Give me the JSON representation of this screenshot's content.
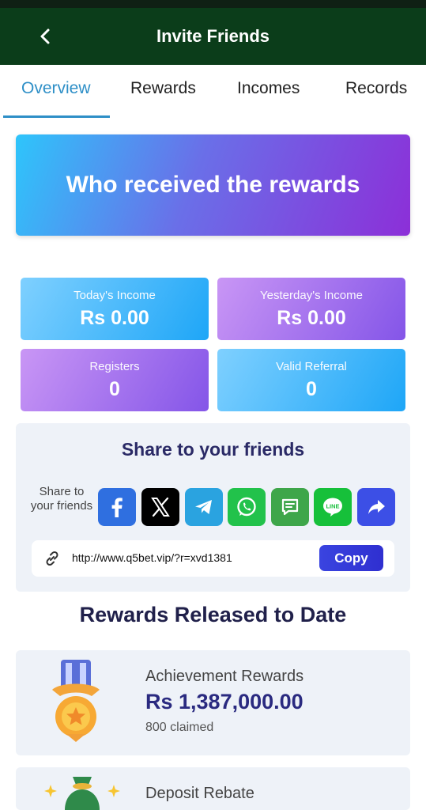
{
  "header": {
    "title": "Invite Friends"
  },
  "tabs": [
    {
      "label": "Overview"
    },
    {
      "label": "Rewards"
    },
    {
      "label": "Incomes"
    },
    {
      "label": "Records"
    }
  ],
  "hero": {
    "text": "Who received the rewards"
  },
  "stats": [
    {
      "label": "Today's Income",
      "value": "Rs 0.00"
    },
    {
      "label": "Yesterday's Income",
      "value": "Rs 0.00"
    },
    {
      "label": "Registers",
      "value": "0"
    },
    {
      "label": "Valid Referral",
      "value": "0"
    }
  ],
  "share": {
    "title": "Share to your friends",
    "label": "Share to your friends",
    "platforms": [
      "facebook-icon",
      "x-icon",
      "telegram-icon",
      "whatsapp-icon",
      "sms-icon",
      "line-icon",
      "share-icon"
    ],
    "line_text": "LINE",
    "link": "http://www.q5bet.vip/?r=xvd1381",
    "copy_label": "Copy"
  },
  "rewards": {
    "heading": "Rewards Released to Date",
    "items": [
      {
        "title": "Achievement Rewards",
        "amount": "Rs 1,387,000.00",
        "claimed": "800 claimed"
      },
      {
        "title": "Deposit Rebate"
      }
    ]
  },
  "colors": {
    "header_bg": "#0b3d1a",
    "accent": "#2e8fc7",
    "heading": "#2a2a66"
  }
}
